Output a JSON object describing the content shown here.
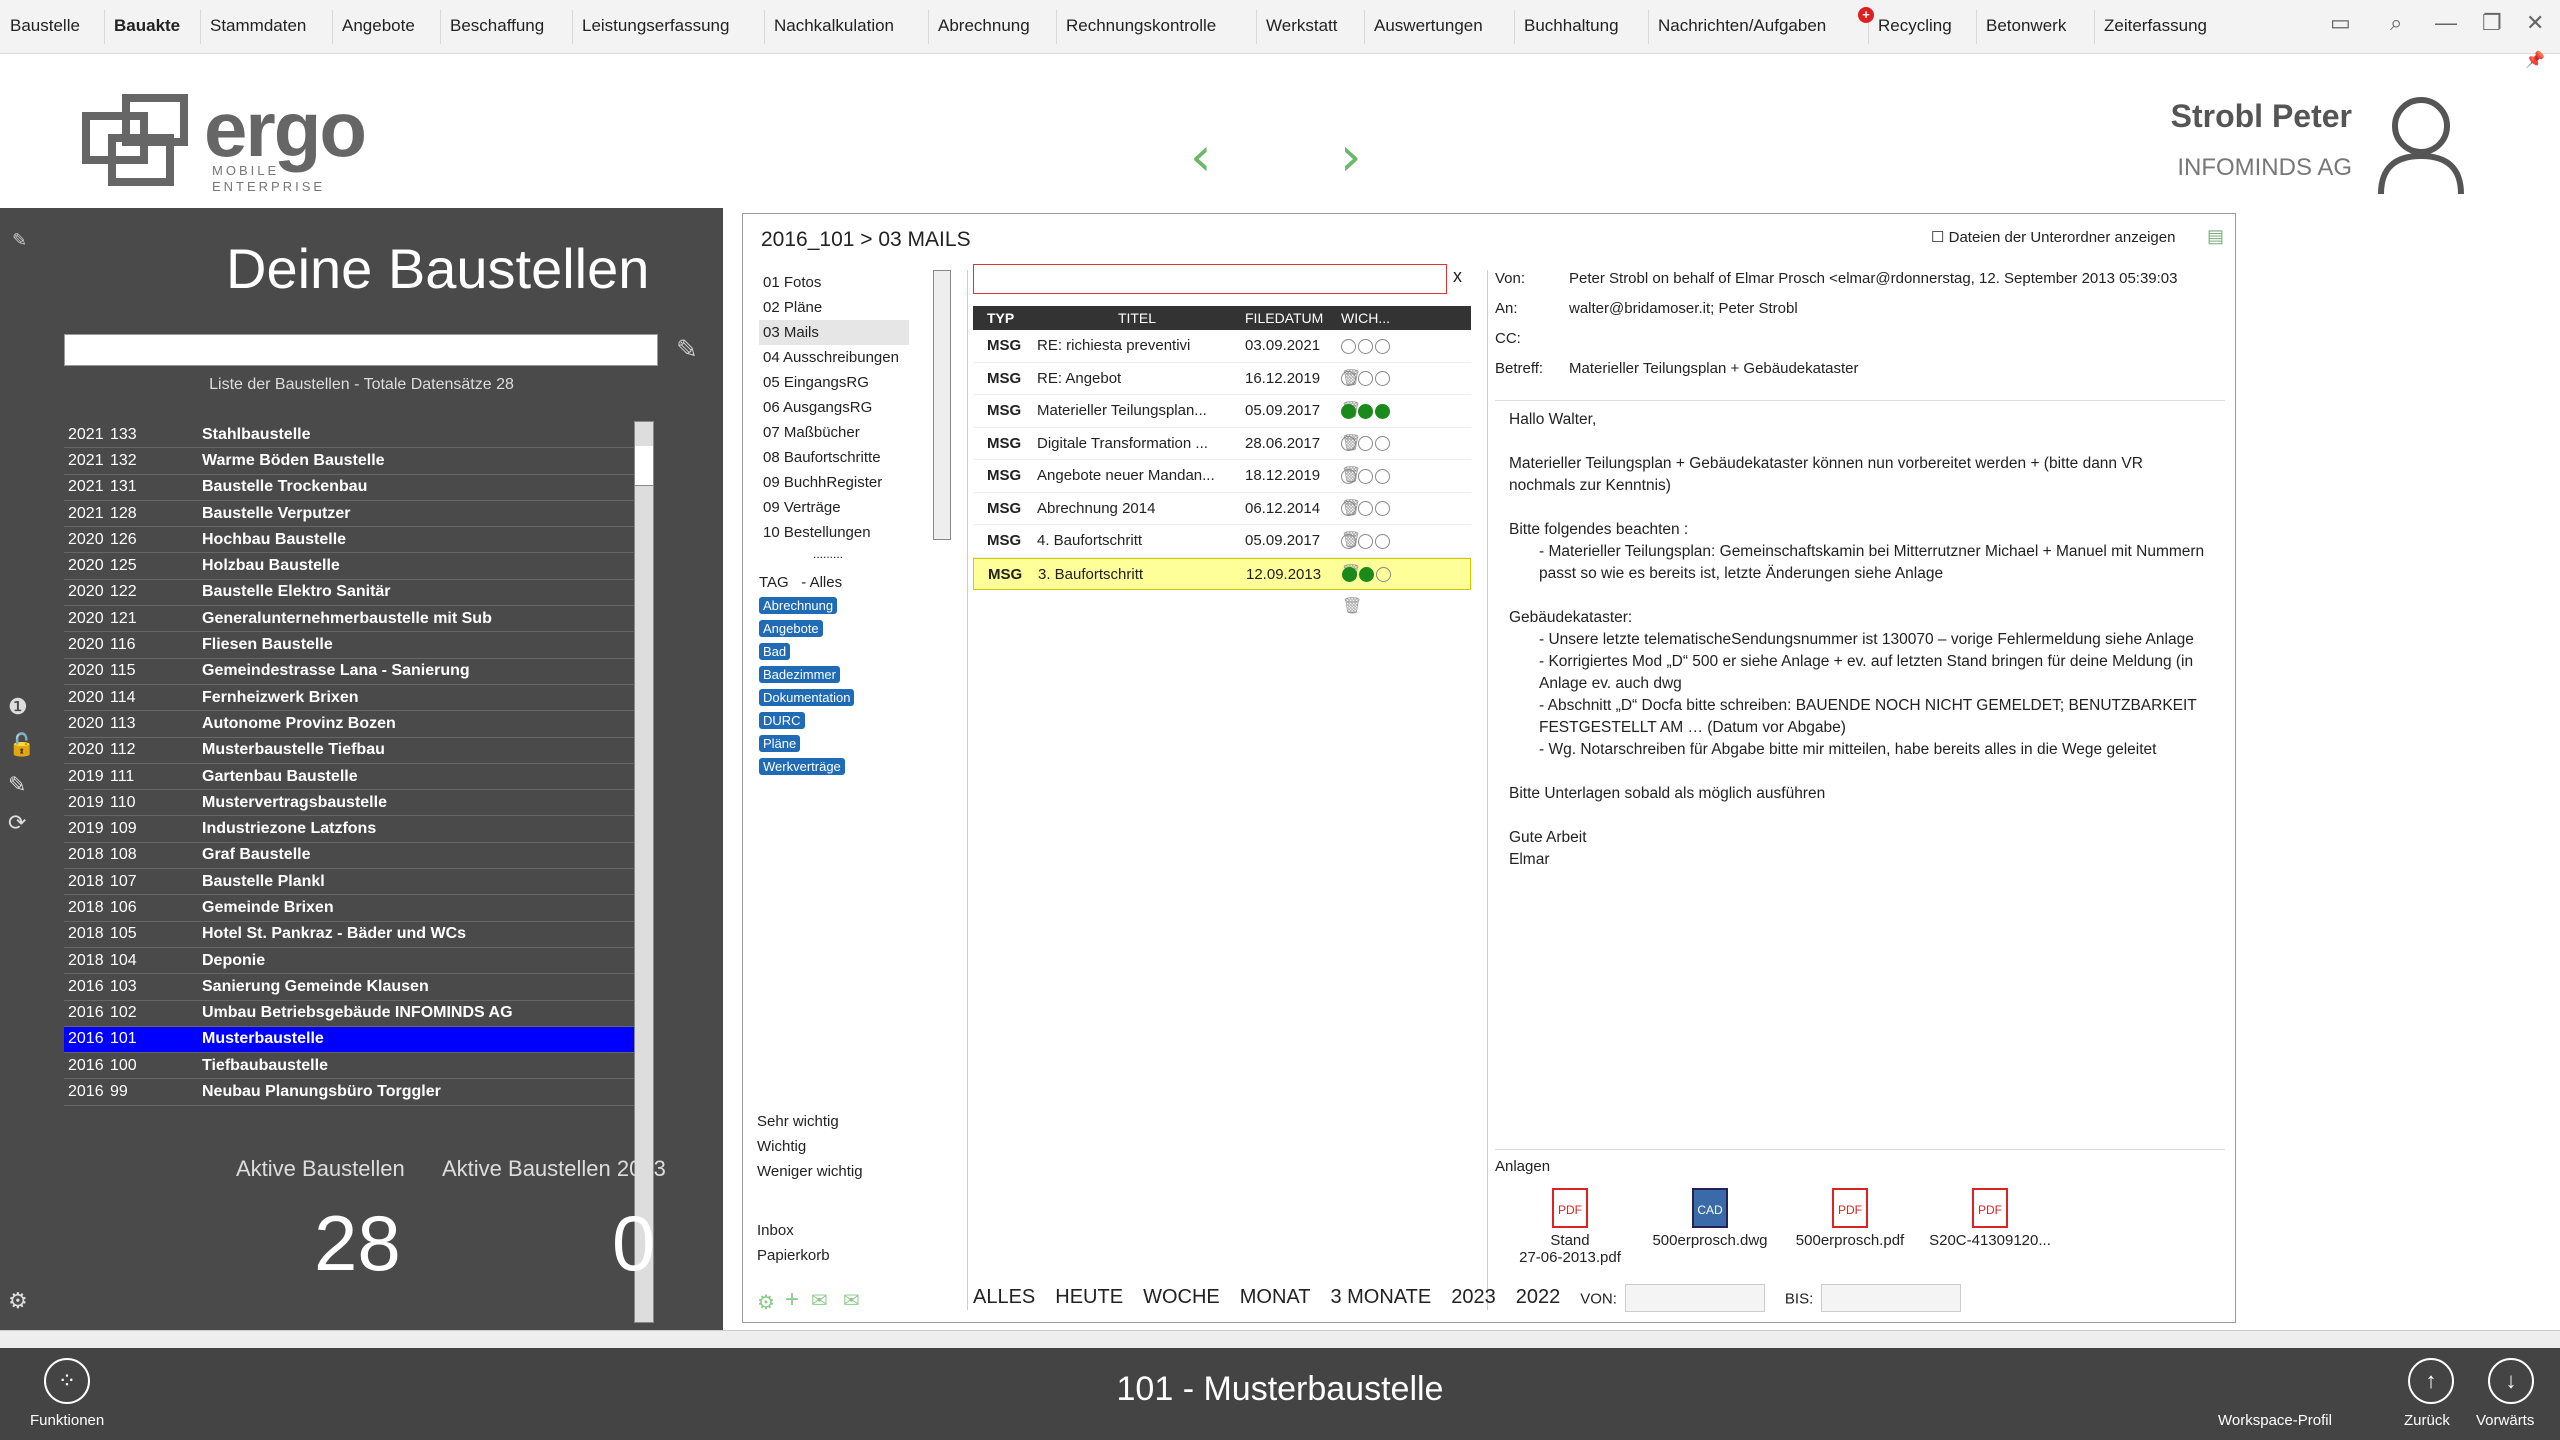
{
  "menu": [
    "Baustelle",
    "Bauakte",
    "Stammdaten",
    "Angebote",
    "Beschaffung",
    "Leistungserfassung",
    "Nachkalkulation",
    "Abrechnung",
    "Rechnungskontrolle",
    "Werkstatt",
    "Auswertungen",
    "Buchhaltung",
    "Nachrichten/Aufgaben",
    "Recycling",
    "Betonwerk",
    "Zeiterfassung"
  ],
  "menu_active": "Bauakte",
  "logo": {
    "text": "ergo",
    "sub1": "MOBILE",
    "sub2": "ENTERPRISE"
  },
  "user": {
    "name": "Strobl Peter",
    "company": "INFOMINDS AG"
  },
  "left": {
    "title": "Deine Baustellen",
    "count_label": "Liste der Baustellen - Totale Datensätze 28",
    "items": [
      {
        "y": "2021",
        "n": "133",
        "name": "Stahlbaustelle"
      },
      {
        "y": "2021",
        "n": "132",
        "name": "Warme Böden Baustelle"
      },
      {
        "y": "2021",
        "n": "131",
        "name": "Baustelle Trockenbau"
      },
      {
        "y": "2021",
        "n": "128",
        "name": "Baustelle Verputzer"
      },
      {
        "y": "2020",
        "n": "126",
        "name": "Hochbau Baustelle"
      },
      {
        "y": "2020",
        "n": "125",
        "name": "Holzbau Baustelle"
      },
      {
        "y": "2020",
        "n": "122",
        "name": "Baustelle Elektro Sanitär"
      },
      {
        "y": "2020",
        "n": "121",
        "name": "Generalunternehmerbaustelle mit Sub"
      },
      {
        "y": "2020",
        "n": "116",
        "name": "Fliesen Baustelle"
      },
      {
        "y": "2020",
        "n": "115",
        "name": "Gemeindestrasse Lana - Sanierung"
      },
      {
        "y": "2020",
        "n": "114",
        "name": "Fernheizwerk Brixen"
      },
      {
        "y": "2020",
        "n": "113",
        "name": "Autonome Provinz Bozen"
      },
      {
        "y": "2020",
        "n": "112",
        "name": "Musterbaustelle Tiefbau"
      },
      {
        "y": "2019",
        "n": "111",
        "name": "Gartenbau Baustelle"
      },
      {
        "y": "2019",
        "n": "110",
        "name": "Mustervertragsbaustelle"
      },
      {
        "y": "2019",
        "n": "109",
        "name": "Industriezone Latzfons"
      },
      {
        "y": "2018",
        "n": "108",
        "name": "Graf Baustelle"
      },
      {
        "y": "2018",
        "n": "107",
        "name": "Baustelle Plankl"
      },
      {
        "y": "2018",
        "n": "106",
        "name": "Gemeinde Brixen"
      },
      {
        "y": "2018",
        "n": "105",
        "name": "Hotel St. Pankraz - Bäder und WCs"
      },
      {
        "y": "2018",
        "n": "104",
        "name": "Deponie"
      },
      {
        "y": "2016",
        "n": "103",
        "name": "Sanierung Gemeinde Klausen"
      },
      {
        "y": "2016",
        "n": "102",
        "name": "Umbau Betriebsgebäude INFOMINDS AG"
      },
      {
        "y": "2016",
        "n": "101",
        "name": "Musterbaustelle"
      },
      {
        "y": "2016",
        "n": "100",
        "name": "Tiefbaubaustelle"
      },
      {
        "y": "2016",
        "n": "99",
        "name": "Neubau Planungsbüro Torggler"
      }
    ],
    "selected_index": 23,
    "stat1_label": "Aktive Baustellen",
    "stat1_value": "28",
    "stat2_label": "Aktive Baustellen 2023",
    "stat2_value": "0"
  },
  "main": {
    "breadcrumb": "2016_101 > 03 MAILS",
    "subfolder_label": "Dateien der Unterordner anzeigen",
    "folders": [
      "01 Fotos",
      "02 Pläne",
      "03 Mails",
      "04 Ausschreibungen",
      "05 EingangsRG",
      "06 AusgangsRG",
      "07 Maßbücher",
      "08 Baufortschritte",
      "09 BuchhRegister",
      "09 Verträge",
      "10 Bestellungen"
    ],
    "folder_selected": 2,
    "tag_label": "TAG",
    "tag_all": "- Alles",
    "tags": [
      "Abrechnung",
      "Angebote",
      "Bad",
      "Badezimmer",
      "Dokumentation",
      "DURC",
      "Pläne",
      "Werkverträge"
    ],
    "prio": [
      "Sehr wichtig",
      "Wichtig",
      "Weniger wichtig"
    ],
    "boxes": [
      "Inbox",
      "Papierkorb"
    ],
    "search_clear": "x",
    "cols": {
      "typ": "TYP",
      "titel": "TITEL",
      "datum": "FILEDATUM",
      "wich": "WICH..."
    },
    "mails": [
      {
        "typ": "MSG",
        "titel": "RE: richiesta preventivi",
        "datum": "03.09.2021",
        "prio": 0
      },
      {
        "typ": "MSG",
        "titel": "RE: Angebot",
        "datum": "16.12.2019",
        "prio": 0
      },
      {
        "typ": "MSG",
        "titel": "Materieller Teilungsplan...",
        "datum": "05.09.2017",
        "prio": 3
      },
      {
        "typ": "MSG",
        "titel": "Digitale Transformation ...",
        "datum": "28.06.2017",
        "prio": 0
      },
      {
        "typ": "MSG",
        "titel": "Angebote neuer Mandan...",
        "datum": "18.12.2019",
        "prio": 0
      },
      {
        "typ": "MSG",
        "titel": "Abrechnung 2014",
        "datum": "06.12.2014",
        "prio": 0
      },
      {
        "typ": "MSG",
        "titel": "4. Baufortschritt",
        "datum": "05.09.2017",
        "prio": 0
      },
      {
        "typ": "MSG",
        "titel": "3. Baufortschritt",
        "datum": "12.09.2013",
        "prio": 2
      }
    ],
    "mail_selected": 7,
    "meta": {
      "von_label": "Von:",
      "von": "Peter Strobl on behalf of Elmar Prosch <elmar@rdonnerstag, 12. September 2013 05:39:03",
      "an_label": "An:",
      "an": "walter@bridamoser.it; Peter Strobl",
      "cc_label": "CC:",
      "cc": "",
      "betreff_label": "Betreff:",
      "betreff": "Materieller Teilungsplan + Gebäudekataster"
    },
    "body": [
      "Hallo Walter,",
      "",
      "Materieller Teilungsplan + Gebäudekataster können nun vorbereitet werden + (bitte dann VR nochmals zur Kenntnis)",
      "",
      "Bitte folgendes beachten :",
      "-    Materieller Teilungsplan: Gemeinschaftskamin bei Mitterrutzner Michael + Manuel mit Nummern passt so wie es bereits ist, letzte Änderungen siehe Anlage",
      "",
      "Gebäudekataster:",
      "-    Unsere letzte telematischeSendungsnummer ist 130070 – vorige Fehlermeldung siehe Anlage",
      "-    Korrigiertes Mod „D“ 500 er siehe Anlage + ev. auf letzten Stand bringen für deine Meldung (in Anlage ev. auch dwg",
      "-    Abschnitt „D“ Docfa bitte schreiben: BAUENDE NOCH NICHT GEMELDET; BENUTZBARKEIT FESTGESTELLT AM … (Datum vor Abgabe)",
      "-    Wg. Notarschreiben für Abgabe bitte mir mitteilen, habe bereits alles in die Wege geleitet",
      "",
      "Bitte Unterlagen sobald als möglich ausführen",
      "",
      "Gute Arbeit",
      "Elmar"
    ],
    "att_label": "Anlagen",
    "attachments": [
      {
        "name": "Stand\n27-06-2013.pdf",
        "type": "PDF"
      },
      {
        "name": "500erprosch.dwg",
        "type": "CAD"
      },
      {
        "name": "500erprosch.pdf",
        "type": "PDF"
      },
      {
        "name": "S20C-41309120...",
        "type": "PDF"
      }
    ],
    "filters": [
      "ALLES",
      "HEUTE",
      "WOCHE",
      "MONAT",
      "3 MONATE",
      "2023",
      "2022"
    ],
    "von_label": "VON:",
    "bis_label": "BIS:"
  },
  "bottom": {
    "title": "101 - Musterbaustelle",
    "funktionen": "Funktionen",
    "workspace": "Workspace-Profil",
    "zurueck": "Zurück",
    "vorwaerts": "Vorwärts"
  }
}
